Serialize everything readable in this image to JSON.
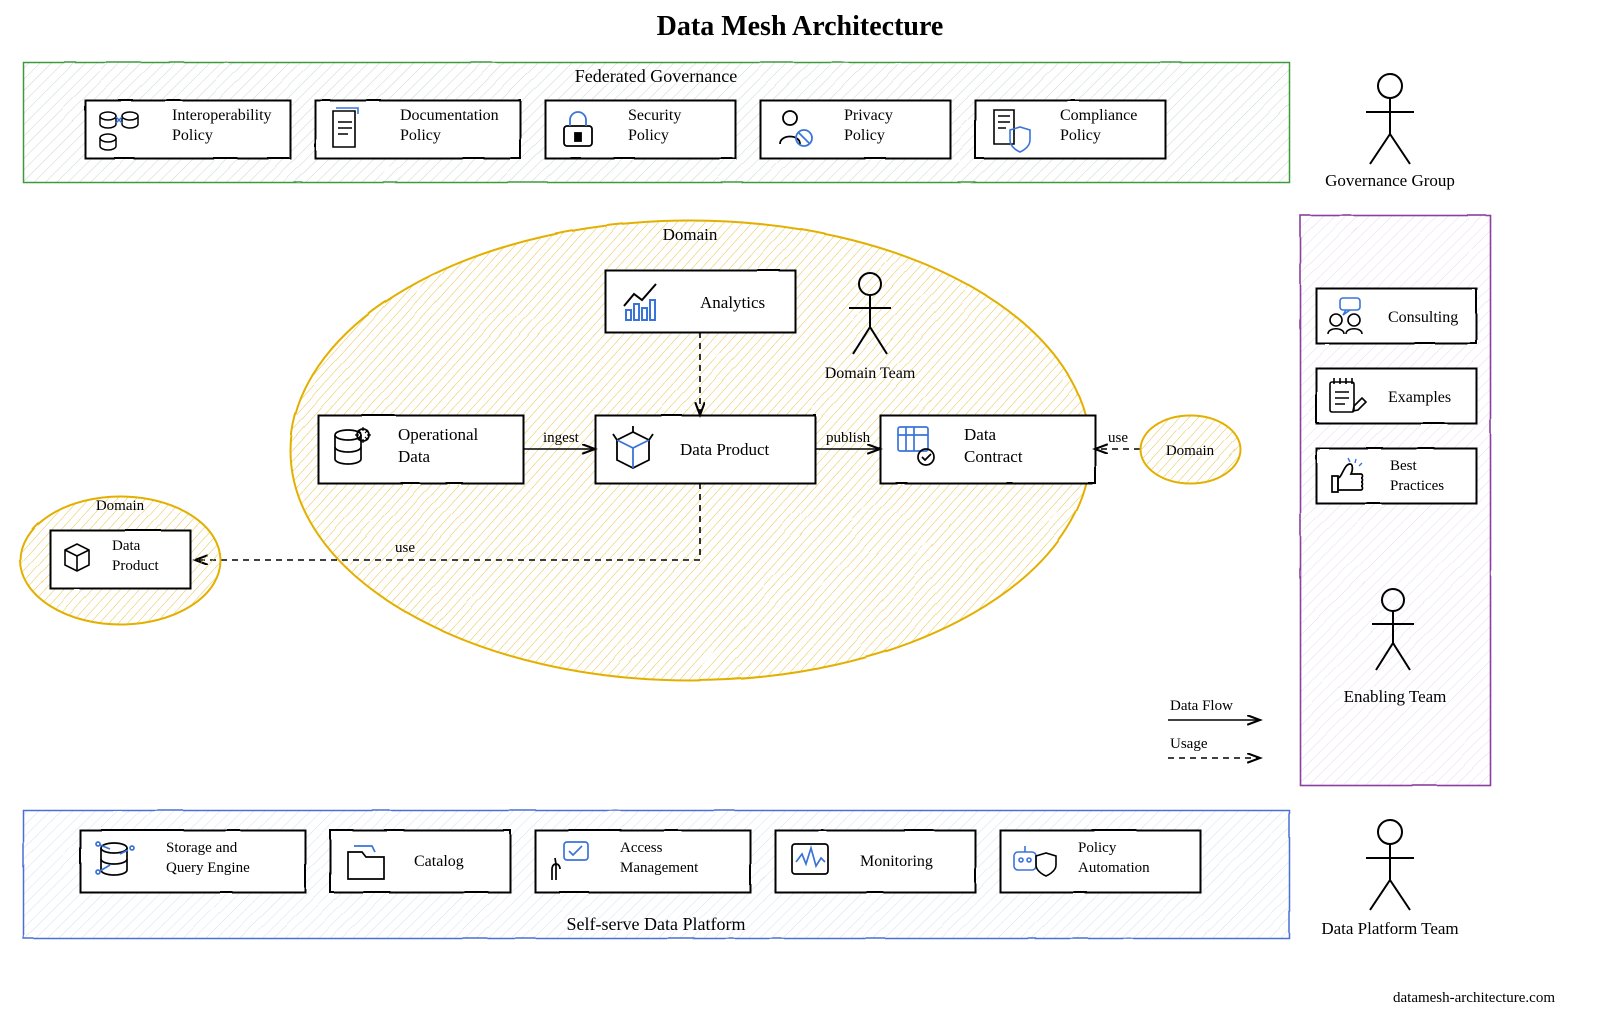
{
  "title": "Data Mesh Architecture",
  "footer": "datamesh-architecture.com",
  "governance": {
    "label": "Federated Governance",
    "team": "Governance Group",
    "policies": [
      {
        "name": "interoperability-policy",
        "label": "Interoperability Policy"
      },
      {
        "name": "documentation-policy",
        "label": "Documentation Policy"
      },
      {
        "name": "security-policy",
        "label": "Security Policy"
      },
      {
        "name": "privacy-policy",
        "label": "Privacy Policy"
      },
      {
        "name": "compliance-policy",
        "label": "Compliance Policy"
      }
    ]
  },
  "domain": {
    "label": "Domain",
    "team": "Domain Team",
    "boxes": {
      "operational": "Operational Data",
      "product": "Data Product",
      "contract": "Data Contract",
      "analytics": "Analytics"
    },
    "edges": {
      "ingest": "ingest",
      "publish": "publish",
      "use1": "use",
      "use2": "use"
    }
  },
  "leftDomain": {
    "label": "Domain",
    "box": "Data Product"
  },
  "rightDomain": {
    "label": "Domain"
  },
  "legend": {
    "flow": "Data Flow",
    "usage": "Usage"
  },
  "enabling": {
    "team": "Enabling Team",
    "items": [
      {
        "name": "consulting",
        "label": "Consulting"
      },
      {
        "name": "examples",
        "label": "Examples"
      },
      {
        "name": "best-practices",
        "label": "Best Practices"
      }
    ]
  },
  "platform": {
    "label": "Self-serve Data Platform",
    "team": "Data Platform Team",
    "items": [
      {
        "name": "storage-query",
        "label": "Storage and Query Engine"
      },
      {
        "name": "catalog",
        "label": "Catalog"
      },
      {
        "name": "access-management",
        "label": "Access Management"
      },
      {
        "name": "monitoring",
        "label": "Monitoring"
      },
      {
        "name": "policy-automation",
        "label": "Policy Automation"
      }
    ]
  }
}
